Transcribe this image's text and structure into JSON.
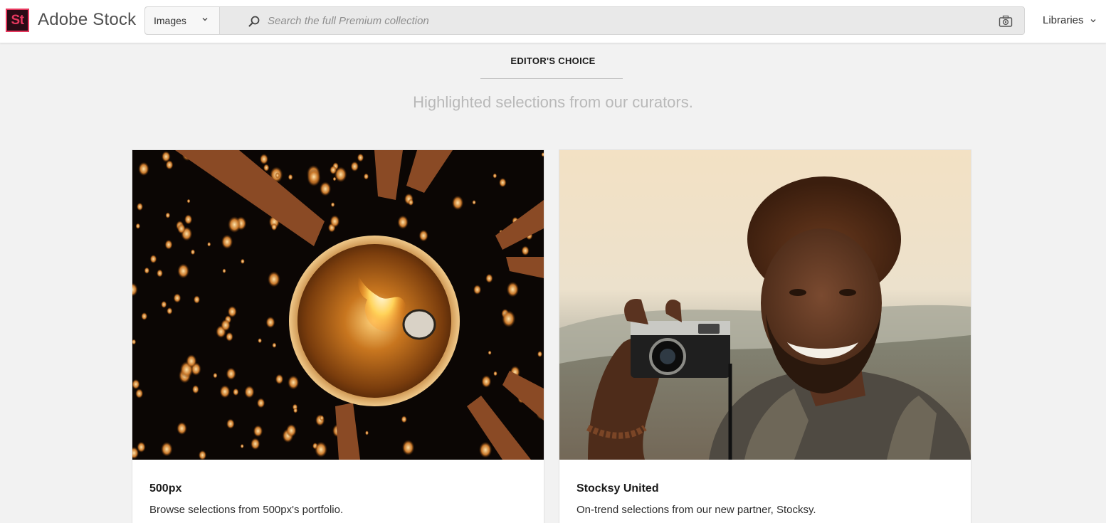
{
  "brand": {
    "logo_mark": "St",
    "name": "Adobe Stock",
    "logo_color": "#e6385e",
    "logo_bg": "#2a0b15"
  },
  "search": {
    "type_selected": "Images",
    "placeholder": "Search the full Premium collection",
    "value": ""
  },
  "nav": {
    "libraries_label": "Libraries"
  },
  "section": {
    "eyebrow": "EDITOR'S CHOICE",
    "subtitle": "Highlighted selections from our curators."
  },
  "cards": [
    {
      "title": "500px",
      "description": "Browse selections from 500px's portfolio.",
      "image": "sky-lantern-festival-photo"
    },
    {
      "title": "Stocksy United",
      "description": "On-trend selections from our new partner, Stocksy.",
      "image": "smiling-man-with-camera-photo"
    }
  ],
  "icons": {
    "type_dropdown": "chevron-down-icon",
    "search": "search-icon",
    "visual_search": "camera-icon",
    "libraries_dropdown": "chevron-down-icon"
  }
}
